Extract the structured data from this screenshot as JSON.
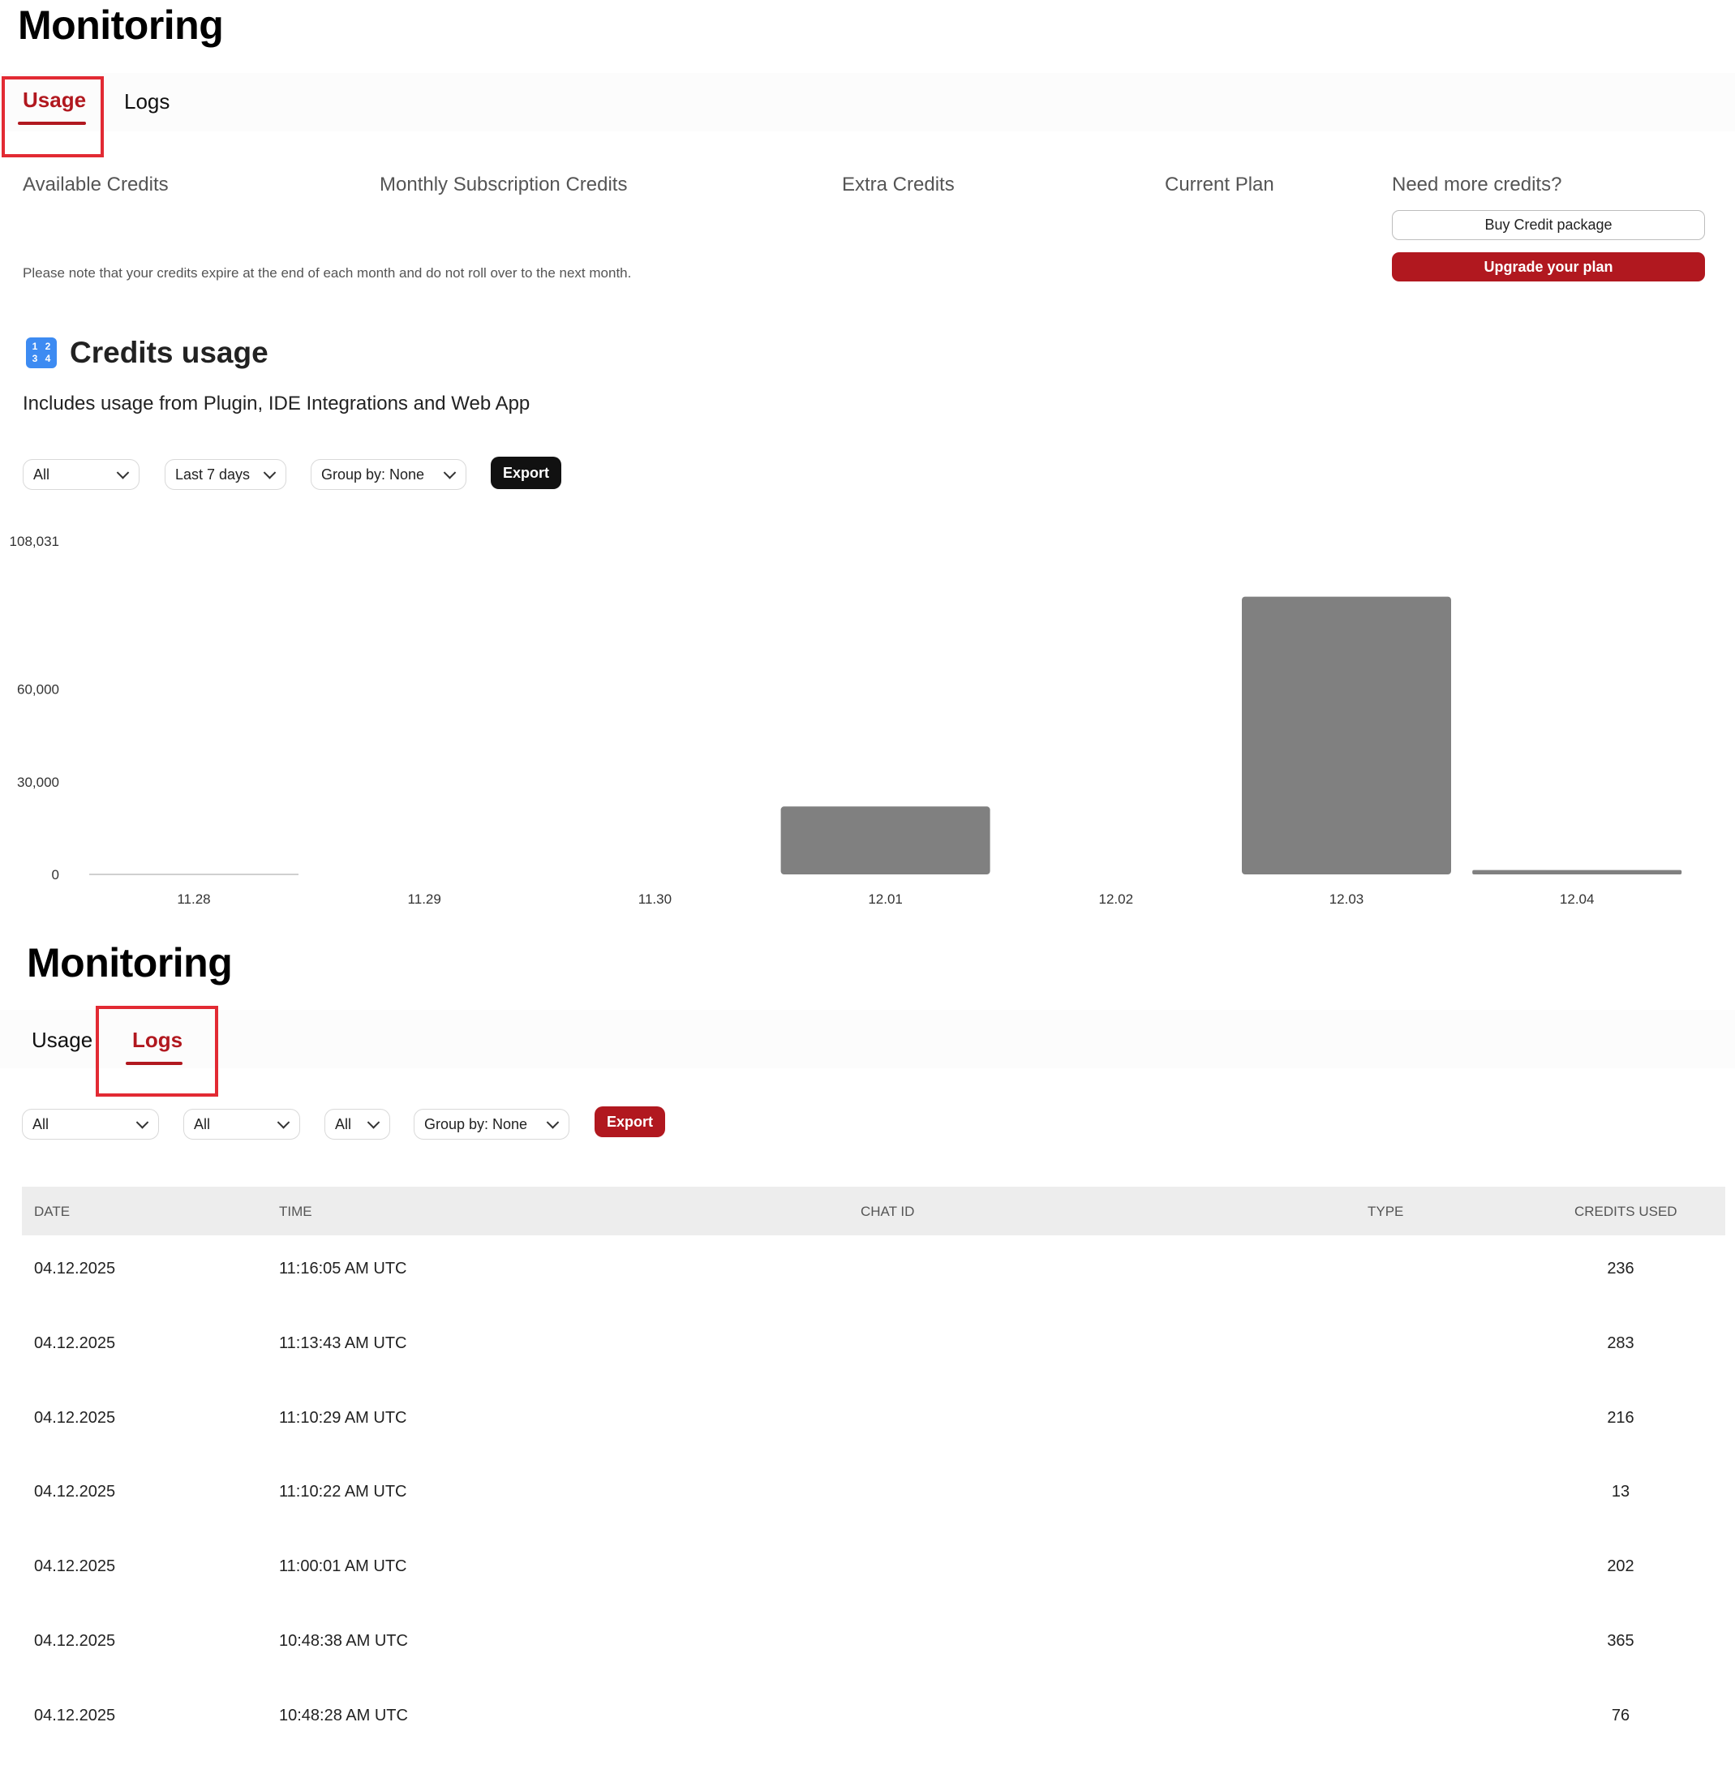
{
  "top": {
    "title": "Monitoring",
    "tabs": [
      {
        "label": "Usage"
      },
      {
        "label": "Logs"
      }
    ],
    "stats": {
      "available": "Available Credits",
      "monthly": "Monthly Subscription Credits",
      "extra": "Extra Credits",
      "plan": "Current Plan",
      "need_more": "Need more credits?"
    },
    "buy_button": "Buy Credit package",
    "upgrade_button": "Upgrade your plan",
    "note": "Please note that your credits expire at the end of each month and do not roll over to the next month.",
    "section": {
      "icon_digits": [
        "1",
        "2",
        "3",
        "4"
      ],
      "title": "Credits usage",
      "subtitle": "Includes usage from Plugin, IDE Integrations and Web App"
    },
    "filters": {
      "source": "All",
      "range": "Last 7 days",
      "group": "Group by: None",
      "export": "Export"
    }
  },
  "chart_data": {
    "type": "bar",
    "categories": [
      "11.28",
      "11.29",
      "11.30",
      "12.01",
      "12.02",
      "12.03",
      "12.04"
    ],
    "values": [
      0,
      0,
      0,
      22000,
      0,
      90000,
      1400
    ],
    "y_ticks": [
      {
        "value": 0,
        "label": "0"
      },
      {
        "value": 30000,
        "label": "30,000"
      },
      {
        "value": 60000,
        "label": "60,000"
      },
      {
        "value": 108031,
        "label": "108,031"
      }
    ],
    "ylim": [
      0,
      108031
    ],
    "bar_color": "#808080",
    "grid": false
  },
  "bottom": {
    "title": "Monitoring",
    "tabs": [
      {
        "label": "Usage"
      },
      {
        "label": "Logs"
      }
    ],
    "filters": {
      "f1": "All",
      "f2": "All",
      "f3": "All",
      "group": "Group by: None",
      "export": "Export"
    },
    "table": {
      "headers": {
        "date": "DATE",
        "time": "TIME",
        "chat_id": "CHAT ID",
        "type": "TYPE",
        "credits": "CREDITS USED"
      },
      "rows": [
        {
          "date": "04.12.2025",
          "time": "11:16:05 AM UTC",
          "credits": "236"
        },
        {
          "date": "04.12.2025",
          "time": "11:13:43 AM UTC",
          "credits": "283"
        },
        {
          "date": "04.12.2025",
          "time": "11:10:29 AM UTC",
          "credits": "216"
        },
        {
          "date": "04.12.2025",
          "time": "11:10:22 AM UTC",
          "credits": "13"
        },
        {
          "date": "04.12.2025",
          "time": "11:00:01 AM UTC",
          "credits": "202"
        },
        {
          "date": "04.12.2025",
          "time": "10:48:38 AM UTC",
          "credits": "365"
        },
        {
          "date": "04.12.2025",
          "time": "10:48:28 AM UTC",
          "credits": "76"
        }
      ]
    }
  }
}
